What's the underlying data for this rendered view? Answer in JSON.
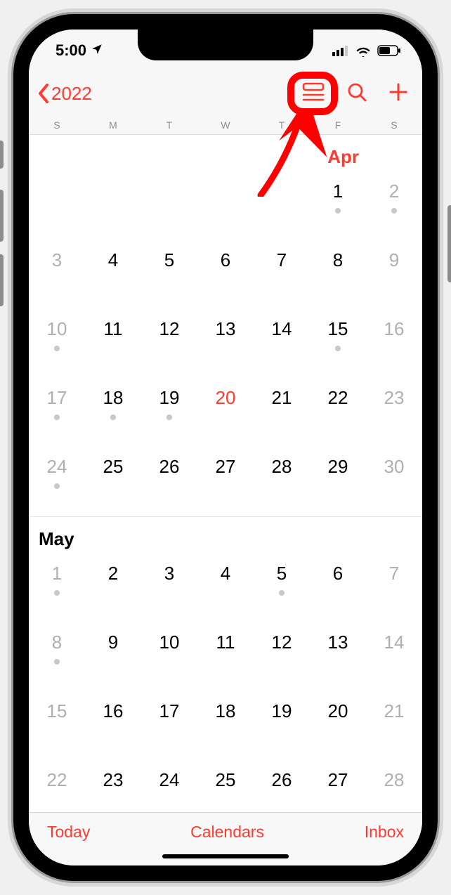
{
  "status": {
    "time": "5:00",
    "location_icon": "location-arrow"
  },
  "nav": {
    "back_label": "2022"
  },
  "weekdays": [
    "S",
    "M",
    "T",
    "W",
    "T",
    "F",
    "S"
  ],
  "months": {
    "april": {
      "label": "Apr",
      "weeks": [
        [
          {
            "n": "",
            "d": false,
            "dot": false
          },
          {
            "n": "",
            "d": false,
            "dot": false
          },
          {
            "n": "",
            "d": false,
            "dot": false
          },
          {
            "n": "",
            "d": false,
            "dot": false
          },
          {
            "n": "",
            "d": false,
            "dot": false
          },
          {
            "n": "1",
            "d": false,
            "dot": true
          },
          {
            "n": "2",
            "d": true,
            "dot": true
          }
        ],
        [
          {
            "n": "3",
            "d": true,
            "dot": false
          },
          {
            "n": "4",
            "d": false,
            "dot": false
          },
          {
            "n": "5",
            "d": false,
            "dot": false
          },
          {
            "n": "6",
            "d": false,
            "dot": false
          },
          {
            "n": "7",
            "d": false,
            "dot": false
          },
          {
            "n": "8",
            "d": false,
            "dot": false
          },
          {
            "n": "9",
            "d": true,
            "dot": false
          }
        ],
        [
          {
            "n": "10",
            "d": true,
            "dot": true
          },
          {
            "n": "11",
            "d": false,
            "dot": false
          },
          {
            "n": "12",
            "d": false,
            "dot": false
          },
          {
            "n": "13",
            "d": false,
            "dot": false
          },
          {
            "n": "14",
            "d": false,
            "dot": false
          },
          {
            "n": "15",
            "d": false,
            "dot": true
          },
          {
            "n": "16",
            "d": true,
            "dot": false
          }
        ],
        [
          {
            "n": "17",
            "d": true,
            "dot": true
          },
          {
            "n": "18",
            "d": false,
            "dot": true
          },
          {
            "n": "19",
            "d": false,
            "dot": true
          },
          {
            "n": "20",
            "d": false,
            "dot": false,
            "today": true
          },
          {
            "n": "21",
            "d": false,
            "dot": false
          },
          {
            "n": "22",
            "d": false,
            "dot": false
          },
          {
            "n": "23",
            "d": true,
            "dot": false
          }
        ],
        [
          {
            "n": "24",
            "d": true,
            "dot": true
          },
          {
            "n": "25",
            "d": false,
            "dot": false
          },
          {
            "n": "26",
            "d": false,
            "dot": false
          },
          {
            "n": "27",
            "d": false,
            "dot": false
          },
          {
            "n": "28",
            "d": false,
            "dot": false
          },
          {
            "n": "29",
            "d": false,
            "dot": false
          },
          {
            "n": "30",
            "d": true,
            "dot": false
          }
        ]
      ]
    },
    "may": {
      "label": "May",
      "weeks": [
        [
          {
            "n": "1",
            "d": true,
            "dot": true
          },
          {
            "n": "2",
            "d": false,
            "dot": false
          },
          {
            "n": "3",
            "d": false,
            "dot": false
          },
          {
            "n": "4",
            "d": false,
            "dot": false
          },
          {
            "n": "5",
            "d": false,
            "dot": true
          },
          {
            "n": "6",
            "d": false,
            "dot": false
          },
          {
            "n": "7",
            "d": true,
            "dot": false
          }
        ],
        [
          {
            "n": "8",
            "d": true,
            "dot": true
          },
          {
            "n": "9",
            "d": false,
            "dot": false
          },
          {
            "n": "10",
            "d": false,
            "dot": false
          },
          {
            "n": "11",
            "d": false,
            "dot": false
          },
          {
            "n": "12",
            "d": false,
            "dot": false
          },
          {
            "n": "13",
            "d": false,
            "dot": false
          },
          {
            "n": "14",
            "d": true,
            "dot": false
          }
        ],
        [
          {
            "n": "15",
            "d": true,
            "dot": false
          },
          {
            "n": "16",
            "d": false,
            "dot": false
          },
          {
            "n": "17",
            "d": false,
            "dot": false
          },
          {
            "n": "18",
            "d": false,
            "dot": false
          },
          {
            "n": "19",
            "d": false,
            "dot": false
          },
          {
            "n": "20",
            "d": false,
            "dot": false
          },
          {
            "n": "21",
            "d": true,
            "dot": false
          }
        ],
        [
          {
            "n": "22",
            "d": true,
            "dot": false
          },
          {
            "n": "23",
            "d": false,
            "dot": false
          },
          {
            "n": "24",
            "d": false,
            "dot": false
          },
          {
            "n": "25",
            "d": false,
            "dot": false
          },
          {
            "n": "26",
            "d": false,
            "dot": false
          },
          {
            "n": "27",
            "d": false,
            "dot": false
          },
          {
            "n": "28",
            "d": true,
            "dot": false
          }
        ]
      ]
    }
  },
  "toolbar": {
    "today": "Today",
    "calendars": "Calendars",
    "inbox": "Inbox"
  },
  "colors": {
    "accent": "#ff3b30"
  }
}
